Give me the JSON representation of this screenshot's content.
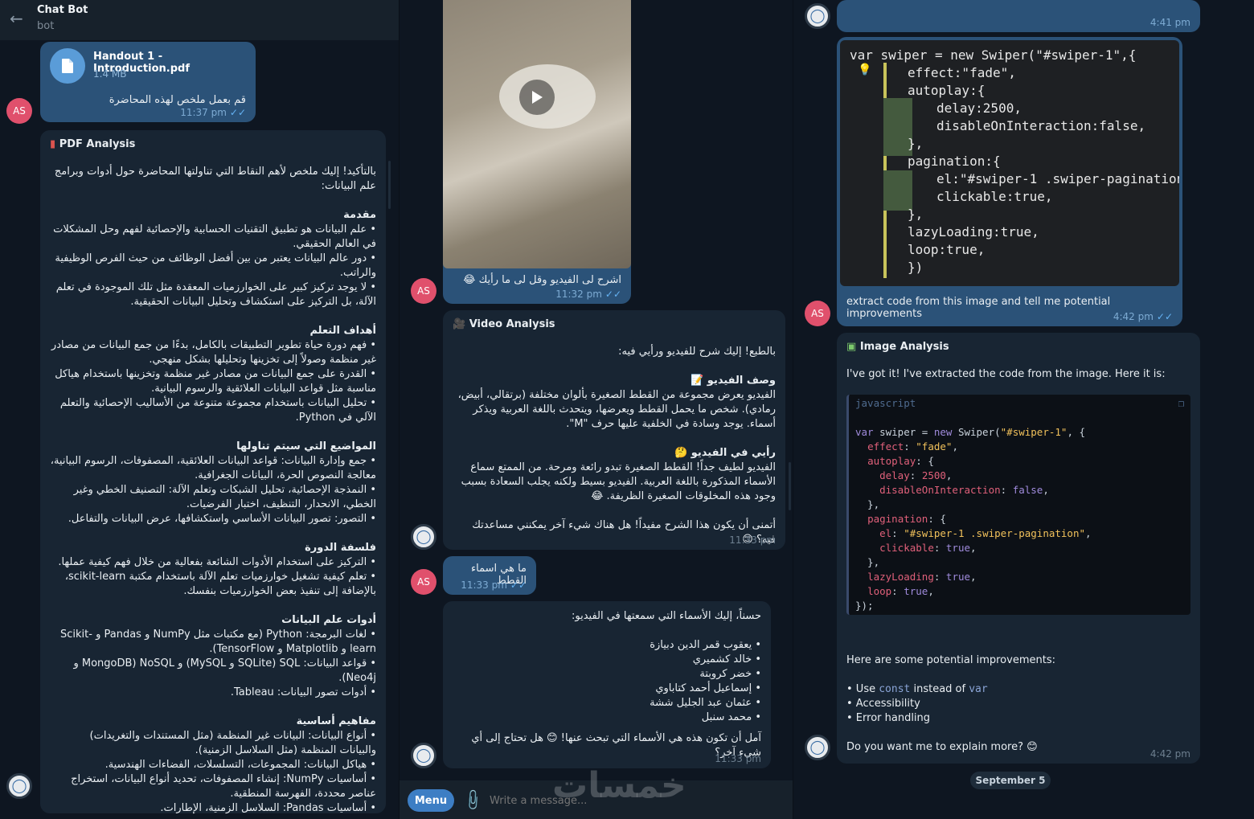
{
  "header": {
    "title": "Chat Bot",
    "subtitle": "bot"
  },
  "avatar_initials": "AS",
  "p1": {
    "file_name": "Handout 1 - Introduction.pdf",
    "file_size": "1.4 MB",
    "file_caption": "قم بعمل ملخص لهذه المحاضرة",
    "file_time": "11:37 pm",
    "analysis_title": "PDF Analysis",
    "intro": "بالتأكيد! إليك ملخص لأهم النقاط التي تناولتها المحاضرة حول أدوات وبرامج علم البيانات:",
    "sections": [
      {
        "title": "مقدمة",
        "items": [
          "• علم البيانات هو تطبيق التقنيات الحسابية والإحصائية لفهم وحل المشكلات في العالم الحقيقي.",
          "• دور عالم البيانات يعتبر من بين أفضل الوظائف من حيث الفرص الوظيفية والراتب.",
          "• لا يوجد تركيز كبير على الخوارزميات المعقدة مثل تلك الموجودة في تعلم الآلة، بل التركيز على استكشاف وتحليل البيانات الحقيقية."
        ]
      },
      {
        "title": "أهداف التعلم",
        "items": [
          "• فهم دورة حياة تطوير التطبيقات بالكامل، بدءًا من جمع البيانات من مصادر غير منظمة وصولاً إلى تخزينها وتحليلها بشكل منهجي.",
          "• القدرة على جمع البيانات من مصادر غير منظمة وتخزينها باستخدام هياكل مناسبة مثل قواعد البيانات العلائقية والرسوم البيانية.",
          "• تحليل البيانات باستخدام مجموعة متنوعة من الأساليب الإحصائية والتعلم الآلي في Python."
        ]
      },
      {
        "title": "المواضيع التي سيتم تناولها",
        "items": [
          "• جمع وإدارة البيانات: قواعد البيانات العلائقية، المصفوفات، الرسوم البيانية، معالجة النصوص الحرة، البيانات الجغرافية.",
          "• النمذجة الإحصائية، تحليل الشبكات وتعلم الآلة: التصنيف الخطي وغير الخطي، الانحدار، التنظيف، اختبار الفرضيات.",
          "• التصور: تصور البيانات الأساسي واستكشافها، عرض البيانات والتفاعل."
        ]
      },
      {
        "title": "فلسفة الدورة",
        "items": [
          "• التركيز على استخدام الأدوات الشائعة بفعالية من خلال فهم كيفية عملها.",
          "• تعلم كيفية تشغيل خوارزميات تعلم الآلة باستخدام مكتبة scikit-learn، بالإضافة إلى تنفيذ بعض الخوارزميات بنفسك."
        ]
      },
      {
        "title": "أدوات علم البيانات",
        "items": [
          "• لغات البرمجة: Python (مع مكتبات مثل NumPy و Pandas و Scikit-learn و Matplotlib و TensorFlow).",
          "• قواعد البيانات: SQL (SQLite و MySQL) و NoSQL (MongoDB و Neo4j).",
          "• أدوات تصور البيانات: Tableau."
        ]
      },
      {
        "title": "مفاهيم أساسية",
        "items": [
          "• أنواع البيانات: البيانات غير المنظمة (مثل المستندات والتغريدات) والبيانات المنظمة (مثل السلاسل الزمنية).",
          "• هياكل البيانات: المجموعات، التسلسلات، الفضاءات الهندسية.",
          "• أساسيات NumPy: إنشاء المصفوفات، تحديد أنواع البيانات، استخراج عناصر محددة، الفهرسة المنطقية.",
          "• أساسيات Pandas: السلاسل الزمنية، الإطارات."
        ]
      }
    ]
  },
  "p2": {
    "video_caption": "اشرح لى الفيديو وقل لى ما رأيك 😂",
    "video_time": "11:32 pm",
    "analysis_title": "Video Analysis",
    "intro": "بالطبع! إليك شرح للفيديو ورأيي فيه:",
    "desc_title": "وصف الفيديو 📝",
    "desc": "الفيديو يعرض مجموعة من القطط الصغيرة بألوان مختلفة (برتقالي، أبيض، رمادي). شخص ما يحمل القطط ويعرضها، ويتحدث باللغة العربية ويذكر أسماء. يوجد وسادة في الخلفية عليها حرف \"M\".",
    "opinion_title": "رأيي في الفيديو 🤔",
    "opinion": "الفيديو لطيف جداً! القطط الصغيرة تبدو رائعة ومرحة. من الممتع سماع الأسماء المذكورة باللغة العربية. الفيديو بسيط ولكنه يجلب السعادة بسبب وجود هذه المخلوقات الصغيرة الظريفة. 😂",
    "closing": "أتمنى أن يكون هذا الشرح مفيداً! هل هناك شيء آخر يمكنني مساعدتك فيه؟ 😊",
    "analysis_time": "11:33 pm",
    "question": "ما هي اسماء القطط",
    "question_time": "11:33 pm",
    "names_intro": "حسناً، إليك الأسماء التي سمعتها في الفيديو:",
    "names": [
      "• يعقوب قمر الدين دبيازة",
      "• خالد كشميري",
      "• خضر كروبتة",
      "• إسماعيل أحمد كتاباوي",
      "• عثمان عبد الجليل ششة",
      "• محمد سنبل"
    ],
    "names_closing": "آمل أن تكون هذه هي الأسماء التي تبحث عنها! 😊 هل تحتاج إلى أي شيء آخر؟",
    "names_time": "11:33 pm",
    "menu": "Menu",
    "input_placeholder": "Write a message..."
  },
  "p3": {
    "top_time": "4:41 pm",
    "photo_lines": [
      "var swiper = new Swiper(\"#swiper-1\",{",
      "effect:\"fade\",",
      "autoplay:{",
      "delay:2500,",
      "disableOnInteraction:false,",
      "},",
      "pagination:{",
      "el:\"#swiper-1 .swiper-pagination\",",
      "clickable:true,",
      "},",
      "lazyLoading:true,",
      "loop:true,",
      "})"
    ],
    "photo_caption": "extract code from this image and tell me potential improvements",
    "photo_time": "4:42 pm",
    "analysis_title": "Image Analysis",
    "intro": "I've got it! I've extracted the code from the image. Here it is:",
    "code_lang": "javascript",
    "improvements_intro": "Here are some potential improvements:",
    "imp1_pre": "• Use ",
    "imp1_code1": "const",
    "imp1_mid": " instead of ",
    "imp1_code2": "var",
    "imp2": "• Accessibility",
    "imp3": "• Error handling",
    "closing": "Do you want me to explain more? 😊",
    "analysis_time": "4:42 pm",
    "date_pill": "September 5"
  },
  "watermark": "خمسات"
}
